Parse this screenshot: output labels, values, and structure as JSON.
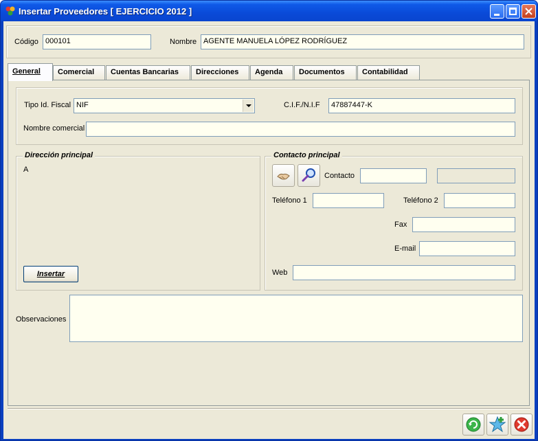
{
  "window": {
    "title": "Insertar Proveedores [ EJERCICIO 2012 ]"
  },
  "header": {
    "codigo_label": "Código",
    "codigo_value": "000101",
    "nombre_label": "Nombre",
    "nombre_value": "AGENTE MANUELA LÓPEZ RODRÍGUEZ"
  },
  "tabs": [
    {
      "label": "General",
      "active": true
    },
    {
      "label": "Comercial"
    },
    {
      "label": "Cuentas Bancarias"
    },
    {
      "label": "Direcciones"
    },
    {
      "label": "Agenda"
    },
    {
      "label": "Documentos"
    },
    {
      "label": "Contabilidad"
    }
  ],
  "general": {
    "tipo_label": "Tipo Id. Fiscal",
    "tipo_value": "NIF",
    "cif_label": "C.I.F./N.I.F",
    "cif_value": "47887447-K",
    "nombre_comercial_label": "Nombre comercial",
    "nombre_comercial_value": ""
  },
  "direccion": {
    "title": "Dirección principal",
    "text": "A",
    "insert_button": "Insertar"
  },
  "contacto": {
    "title": "Contacto principal",
    "contacto_label": "Contacto",
    "telefono1_label": "Teléfono 1",
    "telefono2_label": "Teléfono 2",
    "fax_label": "Fax",
    "email_label": "E-mail",
    "web_label": "Web"
  },
  "observaciones": {
    "label": "Observaciones"
  },
  "colors": {
    "titlebar": "#0a4ad8",
    "field_bg": "#fffff0",
    "window_bg": "#ece9d8"
  }
}
